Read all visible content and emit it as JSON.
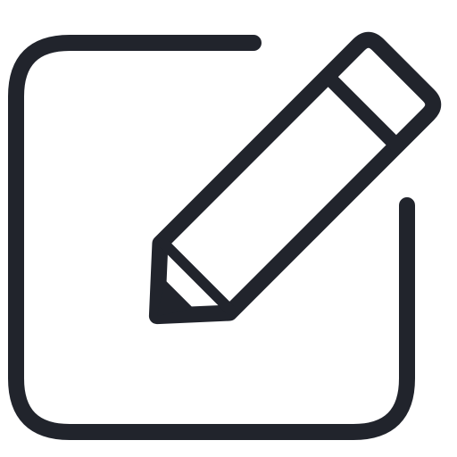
{
  "icon": {
    "name": "edit-icon",
    "parts": [
      "square-frame",
      "pencil"
    ]
  },
  "colors": {
    "stroke": "#21242c",
    "background": "#ffffff"
  }
}
